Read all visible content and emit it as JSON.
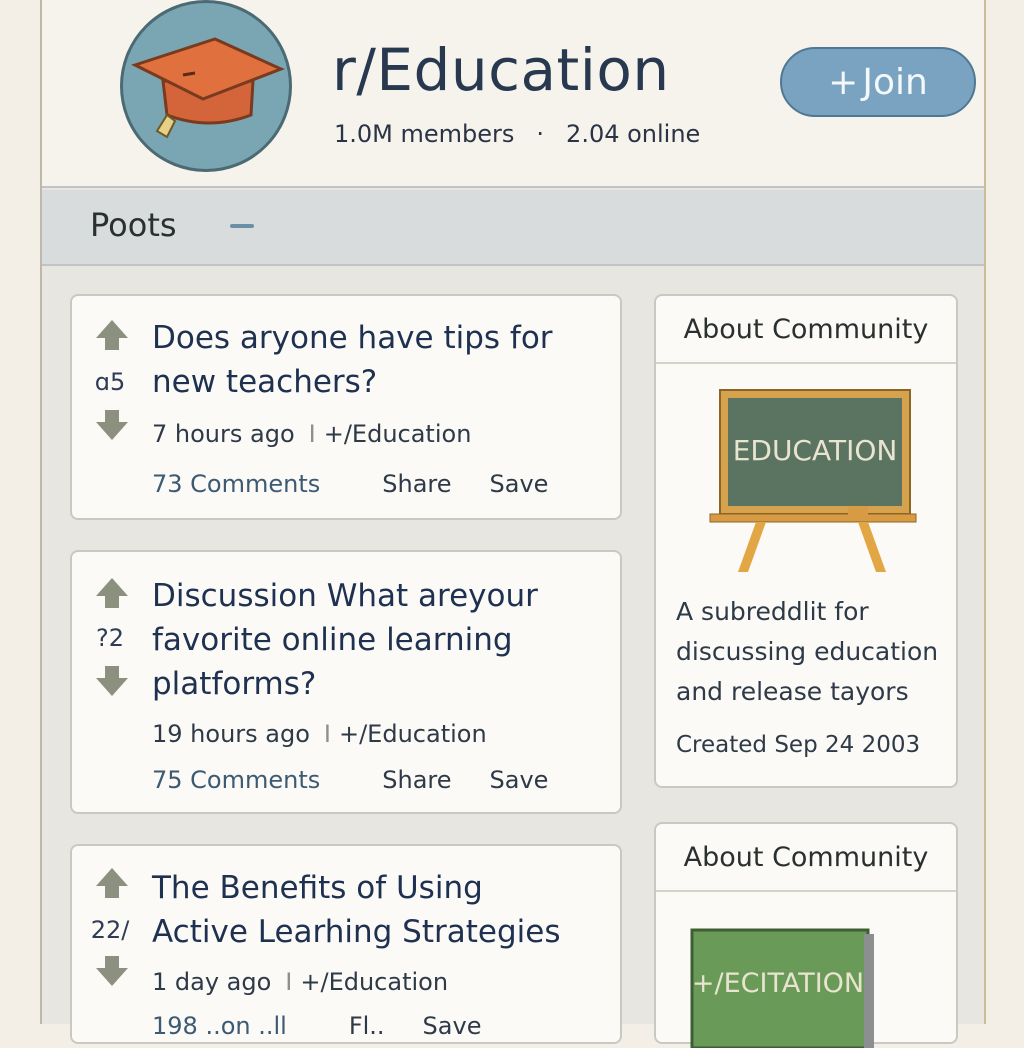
{
  "community": {
    "name": "r/Education",
    "members": "1.0M members",
    "separator": "·",
    "online": "2.04 online",
    "join_label": "Join",
    "join_plus": "+",
    "colors": {
      "accent": "#79a3c1",
      "avatar_bg": "#7aa6b3",
      "cap": "#d4643a"
    }
  },
  "tabs": {
    "active": "Poots"
  },
  "posts": [
    {
      "score": "ɑ5",
      "title_line1": "Does aryone have tips for",
      "title_line2": "new teachers?",
      "age": "7 hours ago",
      "sep": "I",
      "sub": "+/Education",
      "comments": "73 Comments",
      "share": "Share",
      "save": "Save"
    },
    {
      "score": "?2",
      "title_line1": "Discussion What areyour",
      "title_line2": "favorite online learning",
      "title_line3": "platforms?",
      "age": "19 hours ago",
      "sep": "I",
      "sub": "+/Education",
      "comments": "75 Comments",
      "share": "Share",
      "save": "Save"
    },
    {
      "score": "22/",
      "title_line1": "The Benefits of Using",
      "title_line2": "Active Learhing Strategies",
      "age": "1 day ago",
      "sep": "I",
      "sub": "+/Education",
      "comments": "198 ..on ..ll",
      "share": "Fl..",
      "save": "Save"
    }
  ],
  "sidebar": [
    {
      "heading": "About Community",
      "board_text": "EDUCATION",
      "desc_line1": "A subreddlit for",
      "desc_line2": "discussing education",
      "desc_line3": "and release tayors",
      "created": "Created Sep 24 2003"
    },
    {
      "heading": "About Community",
      "book_text": "+/ECITATION"
    }
  ]
}
